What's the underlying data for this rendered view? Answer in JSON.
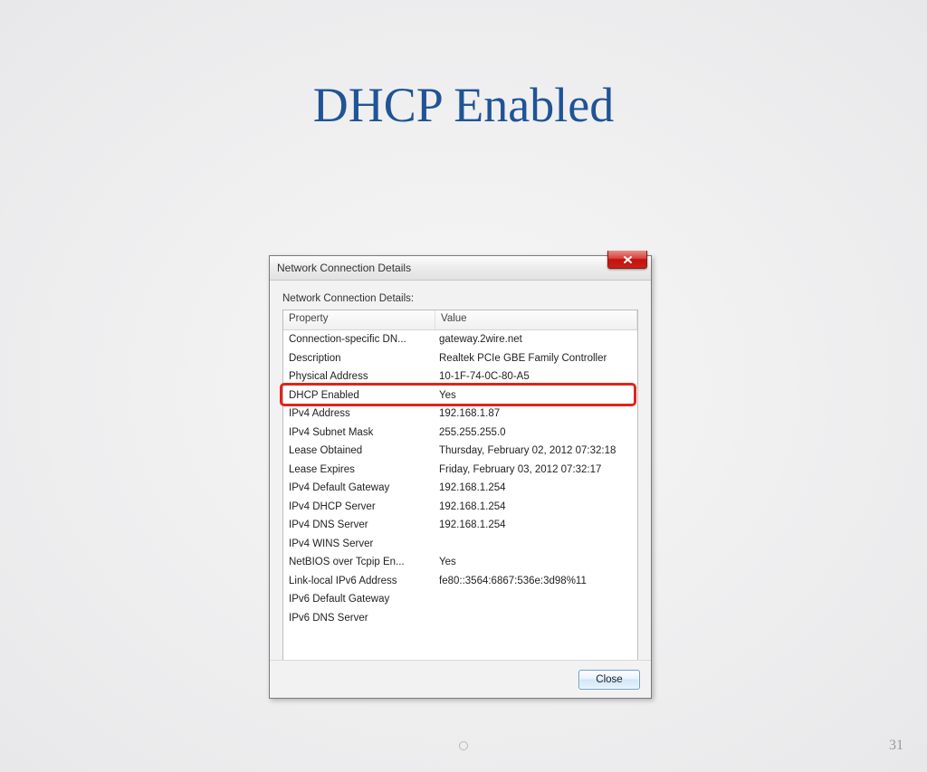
{
  "slide": {
    "title": "DHCP Enabled",
    "page_number": "31"
  },
  "dialog": {
    "title": "Network Connection Details",
    "body_label": "Network Connection Details:",
    "columns": {
      "property": "Property",
      "value": "Value"
    },
    "rows": [
      {
        "property": "Connection-specific DN...",
        "value": "gateway.2wire.net"
      },
      {
        "property": "Description",
        "value": "Realtek PCIe GBE Family Controller"
      },
      {
        "property": "Physical Address",
        "value": "10-1F-74-0C-80-A5"
      },
      {
        "property": "DHCP Enabled",
        "value": "Yes"
      },
      {
        "property": "IPv4 Address",
        "value": "192.168.1.87"
      },
      {
        "property": "IPv4 Subnet Mask",
        "value": "255.255.255.0"
      },
      {
        "property": "Lease Obtained",
        "value": "Thursday, February 02, 2012 07:32:18"
      },
      {
        "property": "Lease Expires",
        "value": "Friday, February 03, 2012 07:32:17"
      },
      {
        "property": "IPv4 Default Gateway",
        "value": "192.168.1.254"
      },
      {
        "property": "IPv4 DHCP Server",
        "value": "192.168.1.254"
      },
      {
        "property": "IPv4 DNS Server",
        "value": "192.168.1.254"
      },
      {
        "property": "IPv4 WINS Server",
        "value": ""
      },
      {
        "property": "NetBIOS over Tcpip En...",
        "value": "Yes"
      },
      {
        "property": "Link-local IPv6 Address",
        "value": "fe80::3564:6867:536e:3d98%11"
      },
      {
        "property": "IPv6 Default Gateway",
        "value": ""
      },
      {
        "property": "IPv6 DNS Server",
        "value": ""
      }
    ],
    "close_label": "Close"
  }
}
